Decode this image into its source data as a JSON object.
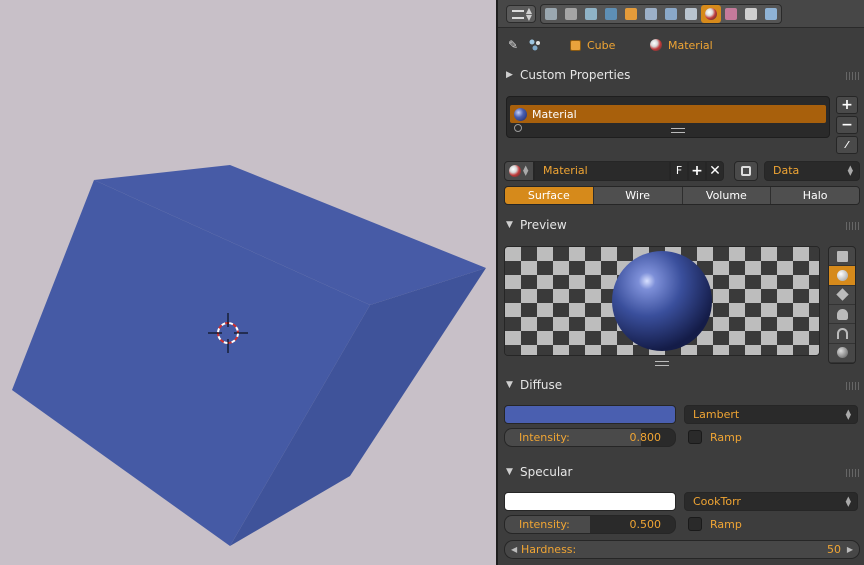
{
  "header": {
    "editor_icon": "properties-editor-icon",
    "context_tabs": [
      {
        "name": "render-icon",
        "color": "#9aa7b0",
        "active": false
      },
      {
        "name": "render-layers-icon",
        "color": "#a5a5a5",
        "active": false
      },
      {
        "name": "scene-icon",
        "color": "#8fb3c7",
        "active": false
      },
      {
        "name": "world-icon",
        "color": "#5e8fb5",
        "active": false
      },
      {
        "name": "object-icon",
        "color": "#e49b3a",
        "active": false
      },
      {
        "name": "constraints-icon",
        "color": "#9cb0c8",
        "active": false
      },
      {
        "name": "modifiers-icon",
        "color": "#8aa8c9",
        "active": false
      },
      {
        "name": "object-data-icon",
        "color": "#b9c4cf",
        "active": false
      },
      {
        "name": "material-icon",
        "color": "#d24040",
        "active": true
      },
      {
        "name": "texture-icon",
        "color": "#c47a9a",
        "active": false
      },
      {
        "name": "particles-icon",
        "color": "#cfcfcf",
        "active": false
      },
      {
        "name": "physics-icon",
        "color": "#8fb3d6",
        "active": false
      }
    ]
  },
  "breadcrumb": {
    "object": "Cube",
    "material": "Material"
  },
  "custom_properties": {
    "label": "Custom Properties"
  },
  "slots": {
    "items": [
      "Material"
    ],
    "add": "+",
    "remove": "−",
    "specials": "⁄"
  },
  "id_row": {
    "name": "Material",
    "fake_user": "F",
    "add": "+",
    "remove": "✕",
    "link": "Data"
  },
  "tabs": [
    "Surface",
    "Wire",
    "Volume",
    "Halo"
  ],
  "active_tab": "Surface",
  "preview": {
    "label": "Preview",
    "shapes": [
      "flat-icon",
      "sphere-icon",
      "cube-icon",
      "monkey-icon",
      "hair-icon",
      "world-sphere-icon"
    ],
    "active_shape": 1
  },
  "diffuse": {
    "label": "Diffuse",
    "color": "#4a5fb0",
    "shader": "Lambert",
    "intensity_label": "Intensity:",
    "intensity": "0.800",
    "intensity_fraction": 0.8,
    "ramp_label": "Ramp",
    "ramp": false
  },
  "specular": {
    "label": "Specular",
    "color": "#ffffff",
    "shader": "CookTorr",
    "intensity_label": "Intensity:",
    "intensity": "0.500",
    "intensity_fraction": 0.5,
    "ramp_label": "Ramp",
    "ramp": false,
    "hardness_label": "Hardness:",
    "hardness": "50"
  },
  "colors": {
    "accent": "#d68a1b",
    "text_orange": "#f0a534",
    "cube": "#4a5fb0"
  }
}
